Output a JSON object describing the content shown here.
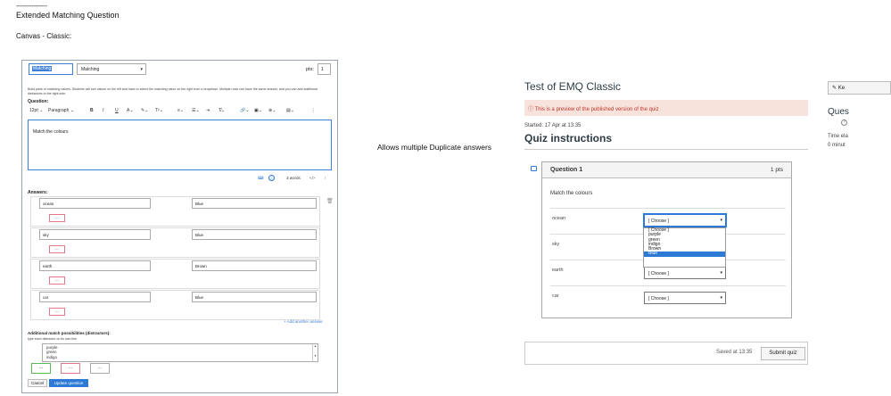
{
  "doc": {
    "dashes": "----------------",
    "title": "Extended Matching Question",
    "subtitle": "Canvas - Classic:",
    "middle_note": "Allows multiple Duplicate answers"
  },
  "editor": {
    "question_name": "Matching",
    "question_type": "Matching",
    "pts_label": "pts:",
    "pts_value": "1",
    "hint": "Build pairs of matching values. Students will see values on the left and have to select the matching value on the right from a dropdown. Multiple rows can have the same answer, and you can add additional distractors to the right side.",
    "question_label": "Question:",
    "toolbar": {
      "font_size": "12pt ⌄",
      "paragraph": "Paragraph ⌄",
      "bold": "B",
      "italic": "I",
      "underline": "U",
      "text_color": "A⌄",
      "highlight": "✎⌄",
      "superscript": "T²⌄",
      "align": "≡⌄",
      "list": "☰⌄",
      "indent": "⇥",
      "clear": "T̸⌄",
      "link": "🔗⌄",
      "image": "▣⌄",
      "media": "⊕⌄",
      "doc": "▤⌄",
      "more": "⋮"
    },
    "body_text": "Match the colours",
    "word_count": "3 words",
    "html_toggle": "</>",
    "answers_label": "Answers:",
    "answers": [
      {
        "left": "ocean",
        "right": "Blue",
        "dots": "..."
      },
      {
        "left": "sky",
        "right": "Blue",
        "dots": "..."
      },
      {
        "left": "earth",
        "right": "Brown",
        "dots": "..."
      },
      {
        "left": "car",
        "right": "Blue",
        "dots": "..."
      }
    ],
    "add_answer": "+ Add another answer",
    "distractors_label": "Additional match possibilities (distractors):",
    "distractors_hint": "type each distractor on its own line",
    "distractors": [
      "purple",
      "green",
      "indigo"
    ],
    "dots_buttons": [
      "...",
      "...",
      "..."
    ],
    "cancel_label": "Cancel",
    "update_label": "Update question"
  },
  "quiz": {
    "title": "Test of EMQ Classic",
    "preview_banner": "ⓘ This is a preview of the published version of the quiz",
    "started": "Started: 17 Apr at 13:35",
    "instructions_heading": "Quiz instructions",
    "question_title": "Question 1",
    "question_pts": "1 pts",
    "prompt": "Match the colours",
    "rows": [
      {
        "label": "ocean",
        "selected": "[ Choose ]"
      },
      {
        "label": "sky",
        "selected": "[ Choose ]"
      },
      {
        "label": "earth",
        "selected": "[ Choose ]"
      },
      {
        "label": "car",
        "selected": "[ Choose ]"
      }
    ],
    "dropdown_options": [
      "[ Choose ]",
      "purple",
      "green",
      "indigo",
      "Brown",
      "Blue"
    ],
    "dropdown_highlighted": "Blue",
    "saved": "Saved at 13:35",
    "submit": "Submit quiz"
  },
  "sidebar": {
    "keep_button": "✎ Ke",
    "questions_heading": "Ques",
    "time_elapsed": "Time ela",
    "minutes": "0 minut"
  },
  "colors": {
    "accent": "#2d7ad6",
    "banner_bg": "#f8e2dc",
    "banner_text": "#c0392b"
  }
}
